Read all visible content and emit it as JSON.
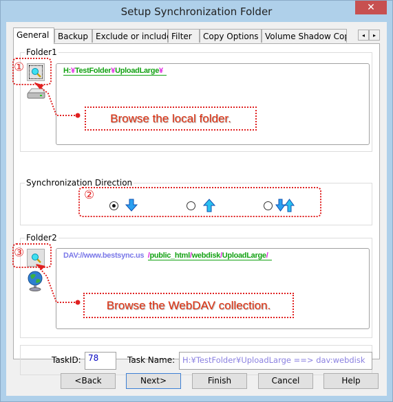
{
  "window": {
    "title": "Setup Synchronization Folder",
    "close_icon": "close-icon"
  },
  "tabs": [
    {
      "label": "General",
      "active": true
    },
    {
      "label": "Backup"
    },
    {
      "label": "Exclude or include"
    },
    {
      "label": "Filter"
    },
    {
      "label": "Copy Options"
    },
    {
      "label": "Volume Shadow Copy"
    }
  ],
  "tab_scroll": {
    "left": "◂",
    "right": "▸"
  },
  "folder1": {
    "label": "Folder1",
    "path_segments": [
      {
        "text": "H:",
        "color": "green"
      },
      {
        "text": "¥",
        "color": "magenta"
      },
      {
        "text": "TestFolder",
        "color": "green"
      },
      {
        "text": "¥",
        "color": "magenta"
      },
      {
        "text": "UploadLarge",
        "color": "green"
      },
      {
        "text": "¥",
        "color": "magenta"
      }
    ],
    "annotation_number": "①",
    "callout": "Browse the local folder.",
    "device_icon": "hard-drive-icon"
  },
  "direction": {
    "label": "Synchronization Direction",
    "annotation_number": "②",
    "options": [
      {
        "name": "download",
        "icon": "arrow-down-icon",
        "checked": true
      },
      {
        "name": "upload",
        "icon": "arrow-up-icon",
        "checked": false
      },
      {
        "name": "bidirectional",
        "icon": "arrows-both-icon",
        "checked": false
      }
    ]
  },
  "folder2": {
    "label": "Folder2",
    "host": "DAV://www.bestsync.us",
    "path_segments": [
      {
        "text": "/",
        "color": "magenta"
      },
      {
        "text": "public_html",
        "color": "green"
      },
      {
        "text": "/",
        "color": "magenta"
      },
      {
        "text": "webdisk",
        "color": "green"
      },
      {
        "text": "/",
        "color": "magenta"
      },
      {
        "text": "UploadLarge",
        "color": "green"
      },
      {
        "text": "/",
        "color": "magenta"
      }
    ],
    "annotation_number": "③",
    "callout": "Browse the WebDAV collection.",
    "device_icon": "globe-icon"
  },
  "task": {
    "id_label": "TaskID:",
    "id_value": "78",
    "name_label": "Task Name:",
    "name_value": "H:¥TestFolder¥UploadLarge ==> dav:webdisk"
  },
  "buttons": {
    "back": "<Back",
    "next": "Next>",
    "finish": "Finish",
    "cancel": "Cancel",
    "help": "Help"
  },
  "colors": {
    "path_green": "#12a112",
    "path_magenta": "#e020e0",
    "host_blue": "#7a78e8",
    "annotation_red": "#e02020",
    "close_red": "#c75050",
    "frame_blue": "#afd0ea"
  }
}
